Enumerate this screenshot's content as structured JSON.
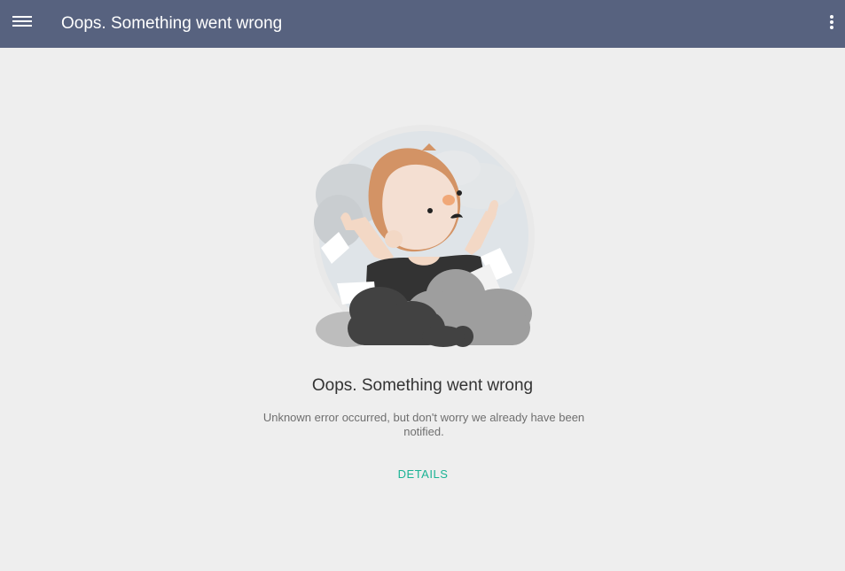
{
  "appbar": {
    "title": "Oops. Something went wrong",
    "menu_icon": "hamburger-menu-icon",
    "overflow_icon": "more-vert-icon",
    "background": "#57627f"
  },
  "error": {
    "illustration": "confused-person-clouds-illustration",
    "title": "Oops. Something went wrong",
    "message": "Unknown error occurred, but don't worry we already have been notified.",
    "details_label": "DETAILS"
  },
  "colors": {
    "page_background": "#eeeeee",
    "accent": "#1bb394"
  }
}
